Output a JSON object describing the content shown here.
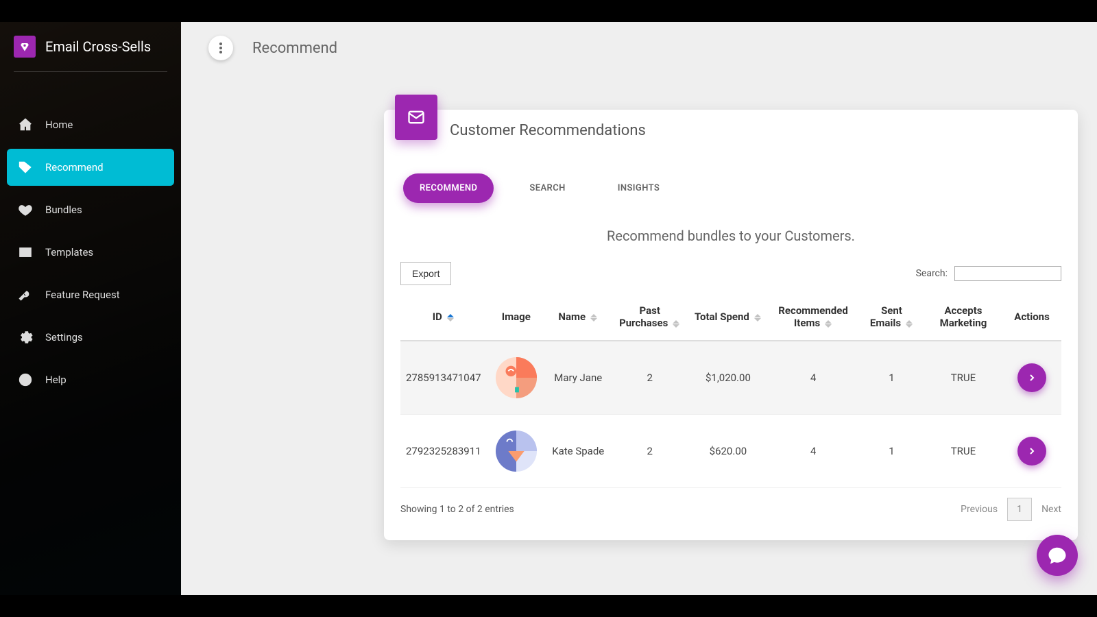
{
  "app": {
    "title": "Email Cross-Sells"
  },
  "sidebar": {
    "items": [
      {
        "label": "Home"
      },
      {
        "label": "Recommend"
      },
      {
        "label": "Bundles"
      },
      {
        "label": "Templates"
      },
      {
        "label": "Feature Request"
      },
      {
        "label": "Settings"
      },
      {
        "label": "Help"
      }
    ]
  },
  "top": {
    "title": "Recommend"
  },
  "card": {
    "title": "Customer Recommendations"
  },
  "tabs": {
    "recommend": "RECOMMEND",
    "search": "SEARCH",
    "insights": "INSIGHTS"
  },
  "section": {
    "subtitle": "Recommend bundles to your Customers."
  },
  "toolbar": {
    "export_label": "Export",
    "search_label": "Search:",
    "search_value": ""
  },
  "table": {
    "headers": {
      "id": "ID",
      "image": "Image",
      "name": "Name",
      "past_purchases": "Past Purchases",
      "total_spend": "Total Spend",
      "recommended_items": "Recommended Items",
      "sent_emails": "Sent Emails",
      "accepts_marketing": "Accepts Marketing",
      "actions": "Actions"
    },
    "rows": [
      {
        "id": "2785913471047",
        "name": "Mary Jane",
        "past_purchases": "2",
        "total_spend": "$1,020.00",
        "recommended_items": "4",
        "sent_emails": "1",
        "accepts_marketing": "TRUE"
      },
      {
        "id": "2792325283911",
        "name": "Kate Spade",
        "past_purchases": "2",
        "total_spend": "$620.00",
        "recommended_items": "4",
        "sent_emails": "1",
        "accepts_marketing": "TRUE"
      }
    ]
  },
  "pagination": {
    "info": "Showing 1 to 2 of 2 entries",
    "previous": "Previous",
    "page": "1",
    "next": "Next"
  }
}
